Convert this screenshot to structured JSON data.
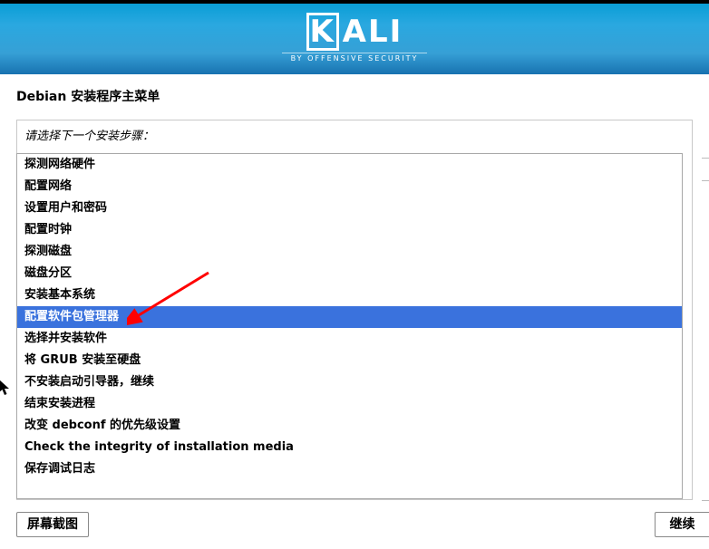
{
  "brand": {
    "name": "KALI",
    "tagline": "BY OFFENSIVE SECURITY"
  },
  "title": "Debian 安装程序主菜单",
  "prompt": "请选择下一个安装步骤：",
  "selected_index": 7,
  "steps": [
    "探测网络硬件",
    "配置网络",
    "设置用户和密码",
    "配置时钟",
    "探测磁盘",
    "磁盘分区",
    "安装基本系统",
    "配置软件包管理器",
    "选择并安装软件",
    "将 GRUB 安装至硬盘",
    "不安装启动引导器，继续",
    "结束安装进程",
    "改变 debconf 的优先级设置",
    "Check the integrity of installation media",
    "保存调试日志"
  ],
  "buttons": {
    "screenshot": "屏幕截图",
    "continue": "继续"
  }
}
